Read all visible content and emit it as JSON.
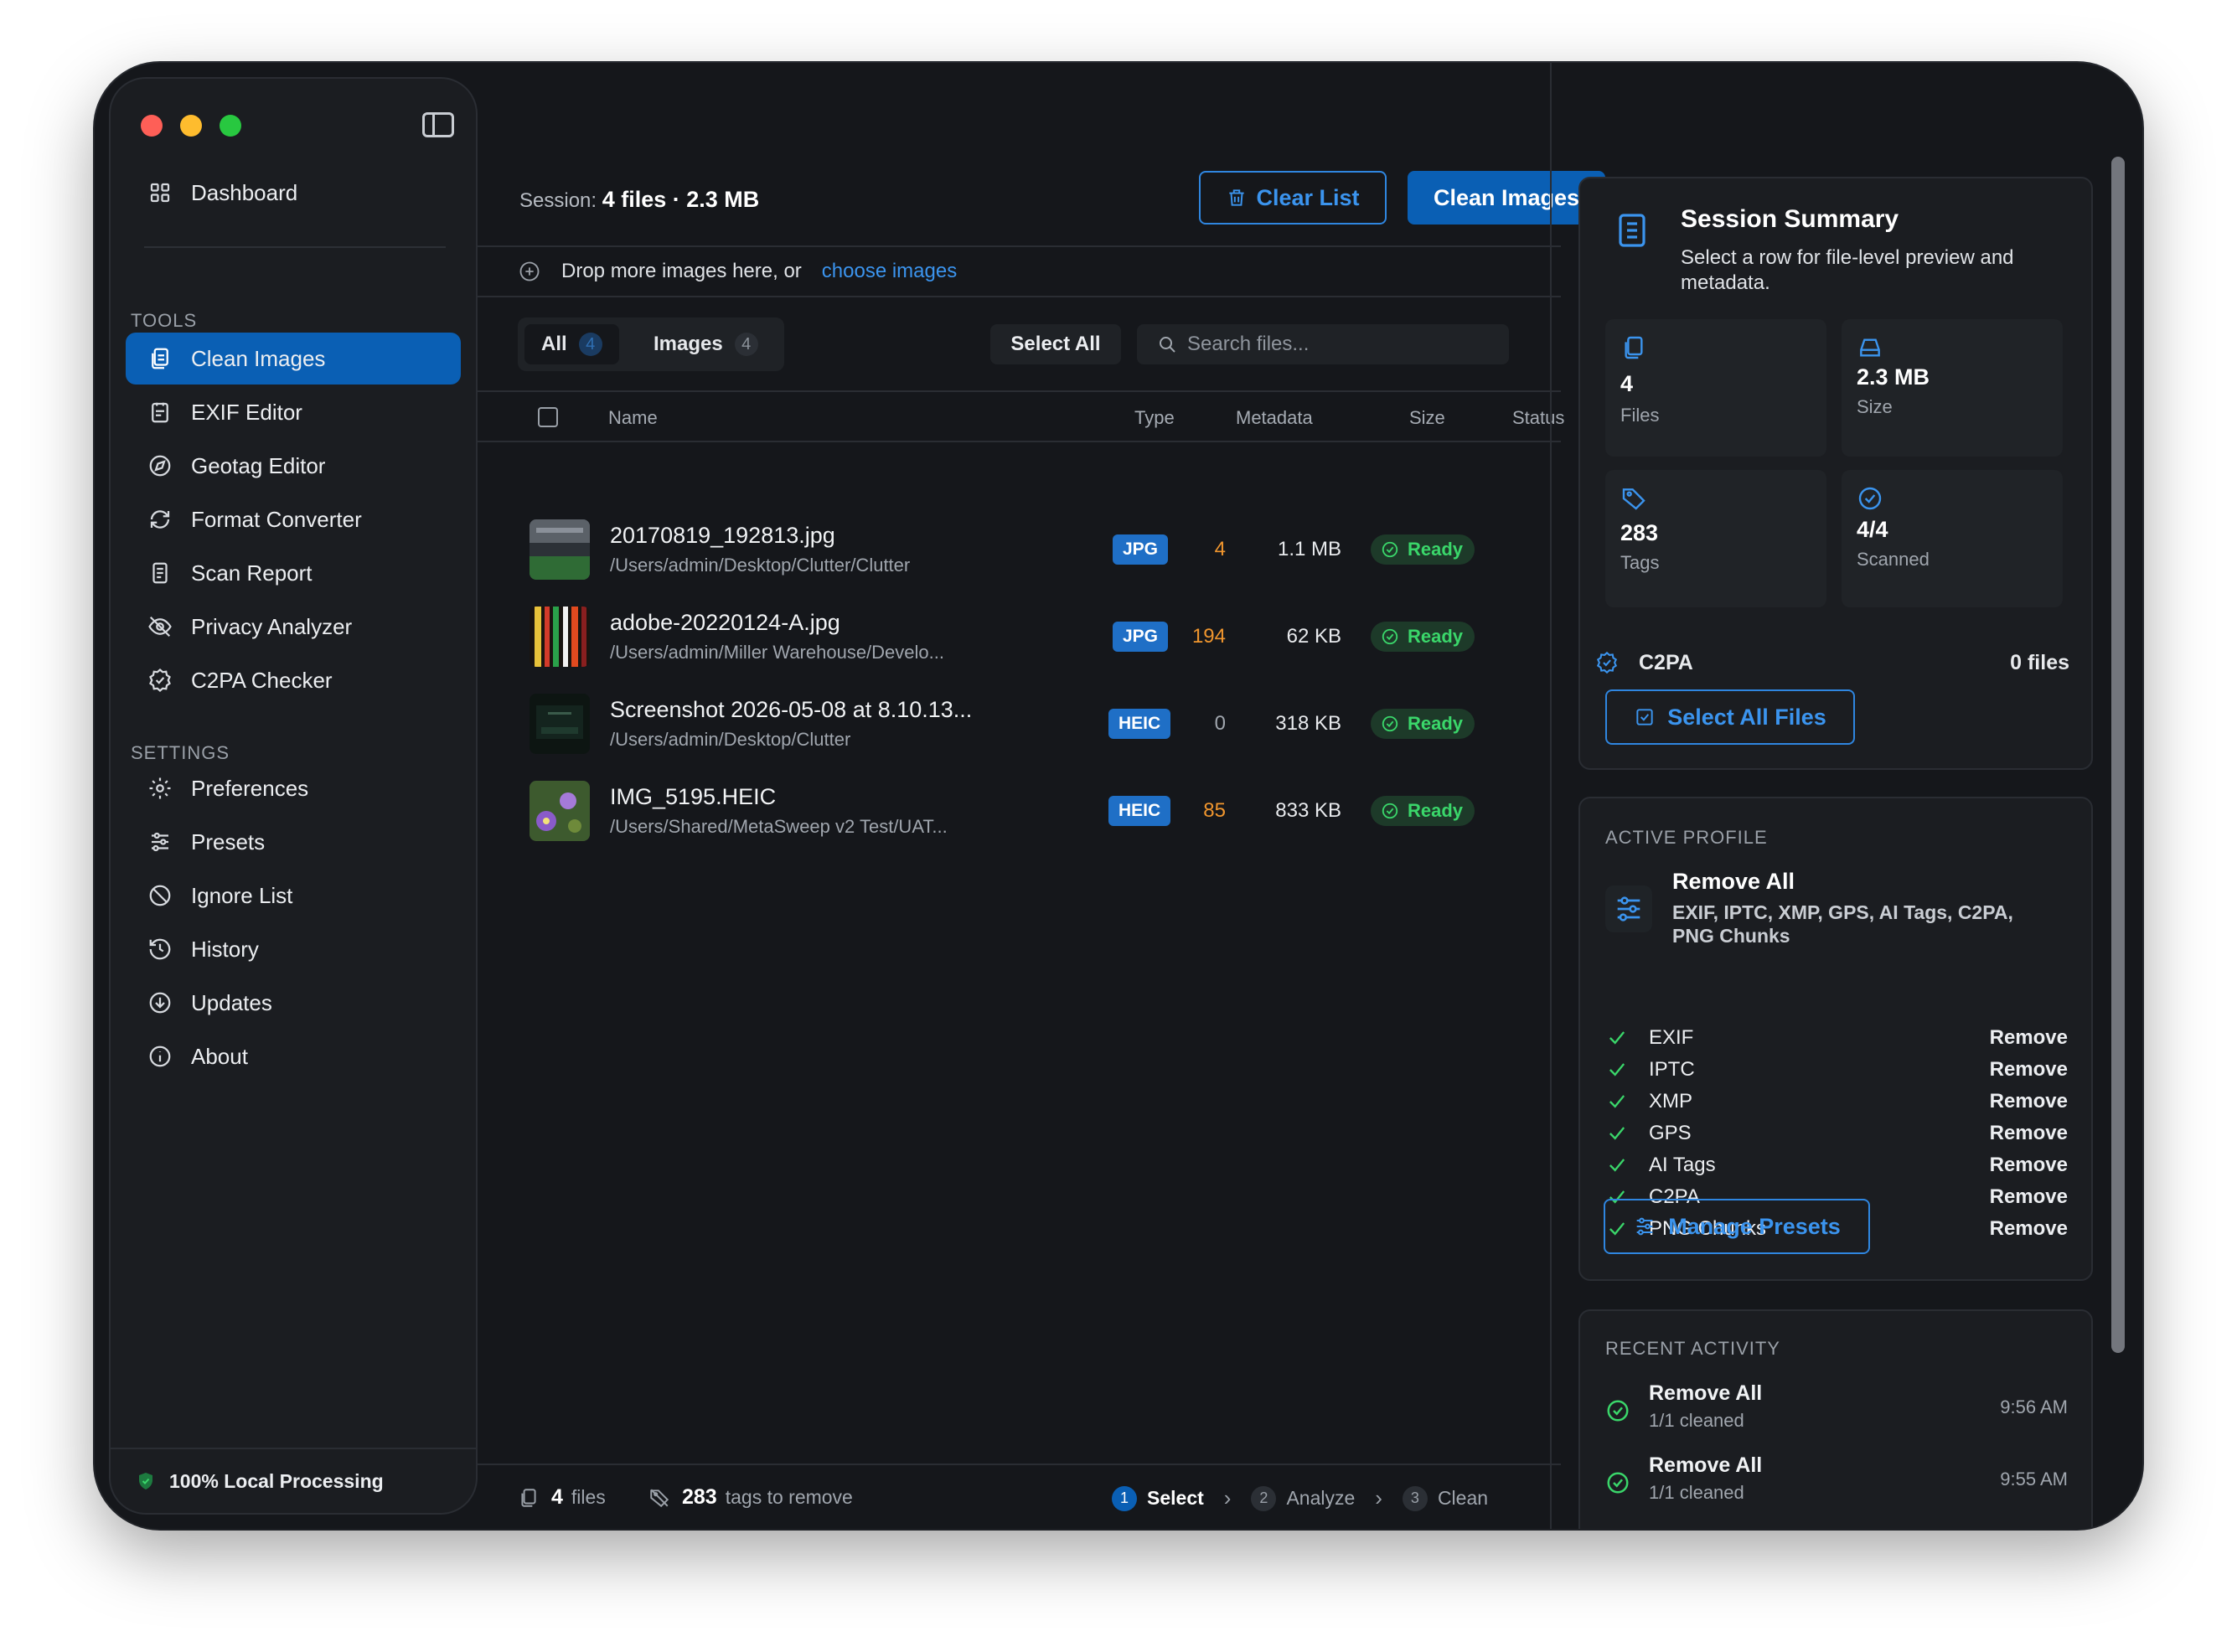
{
  "sidebar": {
    "dashboard": "Dashboard",
    "tools_label": "TOOLS",
    "tools": [
      {
        "label": "Clean Images",
        "icon": "clean-images-icon"
      },
      {
        "label": "EXIF Editor",
        "icon": "exif-editor-icon"
      },
      {
        "label": "Geotag Editor",
        "icon": "geotag-icon"
      },
      {
        "label": "Format Converter",
        "icon": "format-converter-icon"
      },
      {
        "label": "Scan Report",
        "icon": "scan-report-icon"
      },
      {
        "label": "Privacy Analyzer",
        "icon": "privacy-eye-icon"
      },
      {
        "label": "C2PA Checker",
        "icon": "c2pa-badge-icon"
      }
    ],
    "settings_label": "SETTINGS",
    "settings": [
      {
        "label": "Preferences",
        "icon": "gear-icon"
      },
      {
        "label": "Presets",
        "icon": "sliders-icon"
      },
      {
        "label": "Ignore List",
        "icon": "ban-icon"
      },
      {
        "label": "History",
        "icon": "history-icon"
      },
      {
        "label": "Updates",
        "icon": "download-icon"
      },
      {
        "label": "About",
        "icon": "info-icon"
      }
    ],
    "footer": "100% Local Processing"
  },
  "main": {
    "session_label": "Session:",
    "session_value": "4 files · 2.3 MB",
    "clear_list": "Clear List",
    "clean_images": "Clean Images",
    "drop_text": "Drop more images here, or",
    "drop_link": "choose images",
    "tabs": [
      {
        "label": "All",
        "count": "4"
      },
      {
        "label": "Images",
        "count": "4"
      }
    ],
    "select_all": "Select All",
    "search_placeholder": "Search files...",
    "columns": {
      "name": "Name",
      "type": "Type",
      "metadata": "Metadata",
      "size": "Size",
      "status": "Status"
    },
    "files": [
      {
        "name": "20170819_192813.jpg",
        "path": "/Users/admin/Desktop/Clutter/Clutter",
        "type": "JPG",
        "metadata": "4",
        "size": "1.1 MB",
        "status": "Ready"
      },
      {
        "name": "adobe-20220124-A.jpg",
        "path": "/Users/admin/Miller Warehouse/Develo...",
        "type": "JPG",
        "metadata": "194",
        "size": "62 KB",
        "status": "Ready"
      },
      {
        "name": "Screenshot 2026-05-08 at 8.10.13...",
        "path": "/Users/admin/Desktop/Clutter",
        "type": "HEIC",
        "metadata": "0",
        "size": "318 KB",
        "status": "Ready"
      },
      {
        "name": "IMG_5195.HEIC",
        "path": "/Users/Shared/MetaSweep v2 Test/UAT...",
        "type": "HEIC",
        "metadata": "85",
        "size": "833 KB",
        "status": "Ready"
      }
    ],
    "footer": {
      "files_count": "4",
      "files_label": "files",
      "tags_count": "283",
      "tags_label": "tags to remove",
      "steps": [
        {
          "num": "1",
          "label": "Select"
        },
        {
          "num": "2",
          "label": "Analyze"
        },
        {
          "num": "3",
          "label": "Clean"
        }
      ]
    }
  },
  "summary": {
    "title": "Session Summary",
    "description": "Select a row for file-level preview and metadata.",
    "tiles": [
      {
        "value": "4",
        "label": "Files"
      },
      {
        "value": "2.3 MB",
        "label": "Size"
      },
      {
        "value": "283",
        "label": "Tags"
      },
      {
        "value": "4/4",
        "label": "Scanned"
      }
    ],
    "c2pa_label": "C2PA",
    "c2pa_value": "0 files",
    "select_all_files": "Select All Files"
  },
  "profile": {
    "section_label": "ACTIVE PROFILE",
    "name": "Remove All",
    "description": "EXIF, IPTC, XMP, GPS, AI Tags, C2PA, PNG Chunks",
    "items": [
      {
        "label": "EXIF",
        "action": "Remove"
      },
      {
        "label": "IPTC",
        "action": "Remove"
      },
      {
        "label": "XMP",
        "action": "Remove"
      },
      {
        "label": "GPS",
        "action": "Remove"
      },
      {
        "label": "AI Tags",
        "action": "Remove"
      },
      {
        "label": "C2PA",
        "action": "Remove"
      },
      {
        "label": "PNG Chunks",
        "action": "Remove"
      }
    ],
    "manage_presets": "Manage Presets"
  },
  "activity": {
    "section_label": "RECENT ACTIVITY",
    "items": [
      {
        "title": "Remove All",
        "detail": "1/1 cleaned",
        "time": "9:56 AM"
      },
      {
        "title": "Remove All",
        "detail": "1/1 cleaned",
        "time": "9:55 AM"
      }
    ]
  },
  "colors": {
    "accent": "#0a5fb4",
    "link": "#3b94ee",
    "ready_green": "#3ad66a",
    "metadata_orange": "#f0962e"
  }
}
